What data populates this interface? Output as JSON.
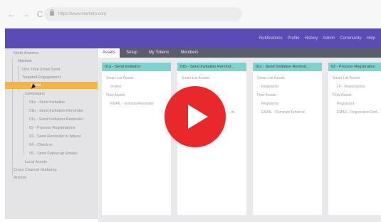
{
  "browser": {
    "url": "https://www.marketo.com",
    "back_icon": "←",
    "forward_icon": "→",
    "reload_icon": "C"
  },
  "header": {
    "nav": [
      "Notifications",
      "Profile",
      "History",
      "Admin",
      "Community",
      "Help"
    ]
  },
  "sidebar": {
    "items": [
      "North America",
      "Markets",
      "One Time Email Send",
      "Targeted Engagement",
      "Event",
      "Campaigns",
      "01a - Send Invitation",
      "01b - Send Invitation Reminder",
      "01c - Send Invitation Reminder",
      "02 - Process Registrations",
      "03 - Send Reminder to Attend",
      "04 - Check-in",
      "05 - Send Follow-up Emails",
      "Local Assets",
      "Cross Channel Nurturing",
      "Archive"
    ],
    "selected": "Event"
  },
  "tabs": [
    "Assets",
    "Setup",
    "My Tokens",
    "Members"
  ],
  "active_tab": "Assets",
  "cards": [
    {
      "title": "01a - Send Invitation",
      "rows": [
        "Smart List Assets",
        "Invited",
        "Flow Assets",
        "EMAIL - InvitationReminder"
      ]
    },
    {
      "title": "01b - Send Invitation Remind...",
      "rows": [
        "Smart List Assets",
        "",
        "",
        "",
        "…ds"
      ]
    },
    {
      "title": "01c - Send Invitation Remind...",
      "rows": [
        "Smart List Assets",
        "Registered",
        "Flow Assets",
        "Registered",
        "EMAIL - ReminderToAttend"
      ]
    },
    {
      "title": "02 - Process Registration",
      "rows": [
        "Smart List Assets",
        "LP - Registrations",
        "Flow Assets",
        "Registered",
        "EMAIL - RegistrationConf..."
      ]
    }
  ],
  "colors": {
    "header": "#5b4bb5",
    "selected_item": "#f2b544",
    "card_header": "#7fd3ce",
    "play_button": "#e8282b"
  },
  "overlay": {
    "icon": "play-button-icon"
  }
}
